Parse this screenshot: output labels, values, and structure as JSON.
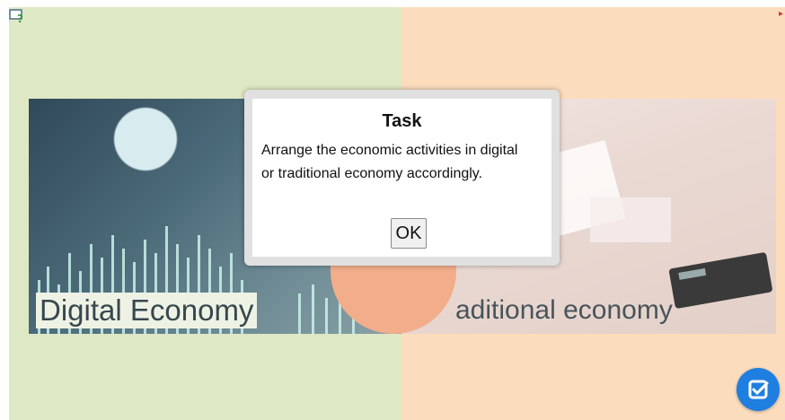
{
  "icons": {
    "help": "help-icon",
    "next": "arrow-right-icon",
    "check": "check-icon"
  },
  "cards": {
    "left_label": "Digital Economy",
    "right_label": "aditional economy"
  },
  "dialog": {
    "title": "Task",
    "text": "Arrange the economic activities in digital or traditional economy accordingly.",
    "ok_label": "OK"
  },
  "colors": {
    "left_bg": "#dfe8c4",
    "right_bg": "#fbdcbc",
    "check_button": "#1f7fe0"
  }
}
